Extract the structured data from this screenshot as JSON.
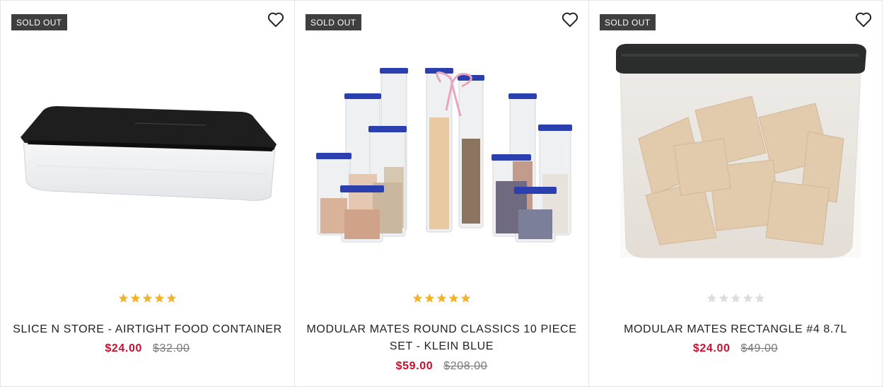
{
  "products": [
    {
      "badge": "SOLD OUT",
      "name": "SLICE N STORE - AIRTIGHT FOOD CONTAINER",
      "sale_price": "$24.00",
      "original_price": "$32.00",
      "rating_stars": 5,
      "image_icon": "slice-n-store-container-image"
    },
    {
      "badge": "SOLD OUT",
      "name": "MODULAR MATES ROUND CLASSICS 10 PIECE SET - KLEIN BLUE",
      "sale_price": "$59.00",
      "original_price": "$208.00",
      "rating_stars": 5,
      "image_icon": "modular-mates-round-set-image"
    },
    {
      "badge": "SOLD OUT",
      "name": "MODULAR MATES RECTANGLE #4 8.7L",
      "sale_price": "$24.00",
      "original_price": "$49.00",
      "rating_stars": 0,
      "image_icon": "modular-mates-rectangle-image"
    }
  ],
  "colors": {
    "badge_bg": "#3f3f3f",
    "star_filled": "#f2b32a",
    "star_empty": "#dcdcdc",
    "sale_price": "#c8102e",
    "original_price": "#777777"
  },
  "icons": {
    "wishlist": "heart-outline-icon",
    "star": "star-icon"
  }
}
